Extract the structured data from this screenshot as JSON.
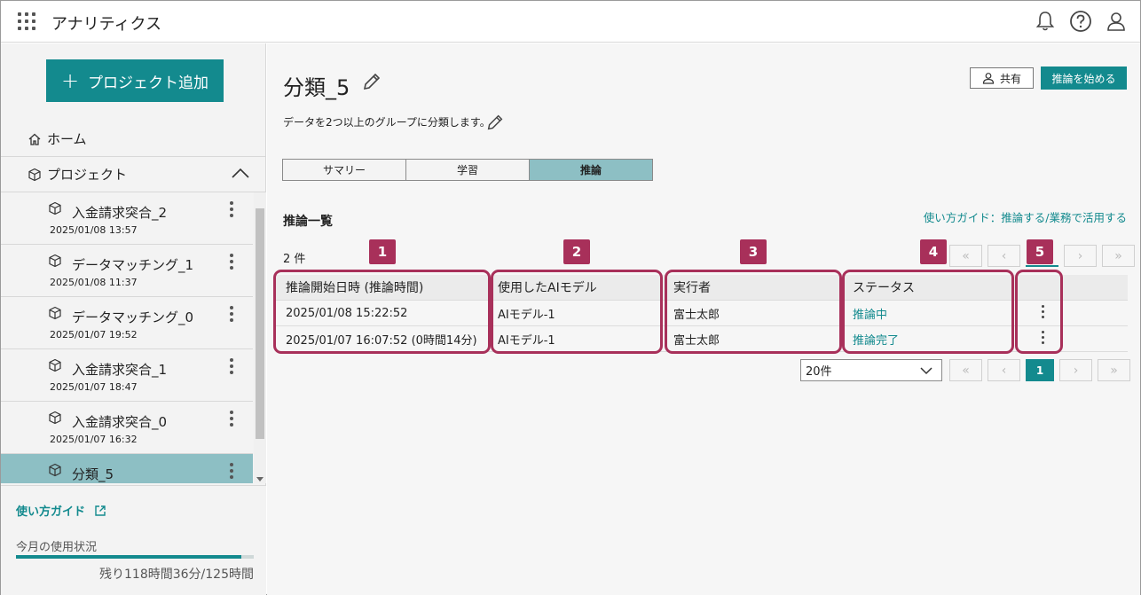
{
  "app": {
    "title": "アナリティクス"
  },
  "sidebar": {
    "add_project_label": "プロジェクト追加",
    "home_label": "ホーム",
    "projects_label": "プロジェクト",
    "projects": [
      {
        "name": "入金請求突合_2",
        "date": "2025/01/08 13:57"
      },
      {
        "name": "データマッチング_1",
        "date": "2025/01/08 11:37"
      },
      {
        "name": "データマッチング_0",
        "date": "2025/01/07 19:52"
      },
      {
        "name": "入金請求突合_1",
        "date": "2025/01/07 18:47"
      },
      {
        "name": "入金請求突合_0",
        "date": "2025/01/07 16:32"
      },
      {
        "name": "分類_5",
        "date": ""
      }
    ],
    "guide_link": "使い方ガイド",
    "usage_label": "今月の使用状況",
    "usage_remaining": "残り118時間36分/125時間",
    "usage_fraction": 0.949
  },
  "main": {
    "title": "分類_5",
    "description": "データを2つ以上のグループに分類します。",
    "share_label": "共有",
    "start_label": "推論を始める",
    "tabs": [
      "サマリー",
      "学習",
      "推論"
    ],
    "active_tab": 2,
    "section_title": "推論一覧",
    "guide_right": "使い方ガイド：推論する/業務で活用する",
    "count": "2 件",
    "page_size": "20件",
    "current_page": "1",
    "table": {
      "headers": [
        "推論開始日時 (推論時間)",
        "使用したAIモデル",
        "実行者",
        "ステータス"
      ],
      "rows": [
        {
          "start": "2025/01/08 15:22:52",
          "model": "AIモデル-1",
          "user": "富士太郎",
          "status": "推論中"
        },
        {
          "start": "2025/01/07 16:07:52 (0時間14分)",
          "model": "AIモデル-1",
          "user": "富士太郎",
          "status": "推論完了"
        }
      ]
    },
    "callouts": [
      "1",
      "2",
      "3",
      "4",
      "5"
    ]
  },
  "colors": {
    "accent": "#138a8e",
    "active_tab": "#8dbfc4",
    "callout": "#a8305a"
  },
  "icons": {
    "top": [
      "bell-icon",
      "help-icon",
      "user-icon"
    ],
    "pager": [
      "first-page-icon",
      "prev-page-icon",
      "next-page-icon",
      "last-page-icon"
    ]
  }
}
